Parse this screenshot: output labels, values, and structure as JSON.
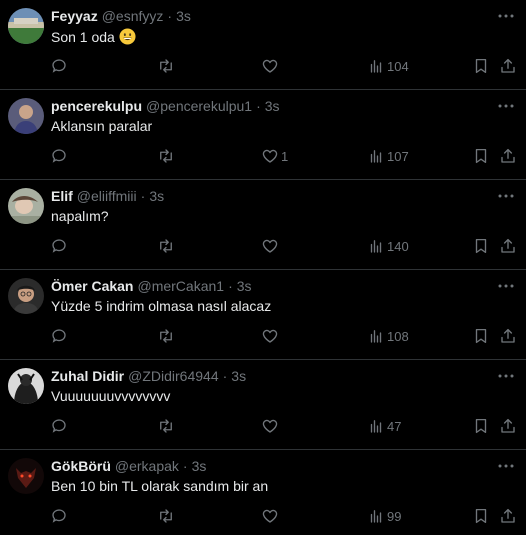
{
  "tweets": [
    {
      "name": "Feyyaz",
      "handle": "@esnfyyz",
      "time": "3s",
      "text": "Son 1 oda",
      "emoji": "grinning-face-emoji",
      "replies": "",
      "retweets": "",
      "likes": "",
      "views": "104",
      "avatar": "avatar-stadium"
    },
    {
      "name": "pencerekulpu",
      "handle": "@pencerekulpu1",
      "time": "3s",
      "text": "Aklansın paralar",
      "emoji": "",
      "replies": "",
      "retweets": "",
      "likes": "1",
      "views": "107",
      "avatar": "avatar-person"
    },
    {
      "name": "Elif",
      "handle": "@eliiffmiii",
      "time": "3s",
      "text": "napalım?",
      "emoji": "",
      "replies": "",
      "retweets": "",
      "likes": "",
      "views": "140",
      "avatar": "avatar-person"
    },
    {
      "name": "Ömer Cakan",
      "handle": "@merCakan1",
      "time": "3s",
      "text": "Yüzde 5 indrim olmasa nasıl alacaz",
      "emoji": "",
      "replies": "",
      "retweets": "",
      "likes": "",
      "views": "108",
      "avatar": "avatar-person"
    },
    {
      "name": "Zuhal Didir",
      "handle": "@ZDidir64944",
      "time": "3s",
      "text": "Vuuuuuuuvvvvvvvv",
      "emoji": "",
      "replies": "",
      "retweets": "",
      "likes": "",
      "views": "47",
      "avatar": "avatar-person"
    },
    {
      "name": "GökBörü",
      "handle": "@erkapak",
      "time": "3s",
      "text": "Ben 10 bin TL olarak sandım bir an",
      "emoji": "",
      "replies": "",
      "retweets": "",
      "likes": "",
      "views": "99",
      "avatar": "avatar-wolf"
    }
  ],
  "colors": {
    "background": "#000000",
    "text": "#e7e9ea",
    "muted": "#71767b",
    "divider": "#2f3336"
  },
  "icons": [
    "more-icon",
    "reply-icon",
    "retweet-icon",
    "like-icon",
    "views-icon",
    "bookmark-icon",
    "share-icon"
  ]
}
